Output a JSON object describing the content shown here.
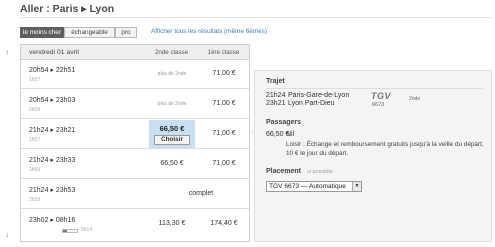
{
  "header": {
    "title": "Aller : Paris ▸ Lyon"
  },
  "filters": {
    "options": [
      "le moins cher",
      "échangeable",
      "pro"
    ],
    "active": "le moins cher",
    "show_all_fares": "Afficher tous les résultats (même 6èmes)"
  },
  "nav": {
    "up": "↑",
    "down": "↓"
  },
  "list": {
    "date": "vendredi 01 avril",
    "col_second": "2nde classe",
    "col_first": "1ère classe",
    "rows": [
      {
        "times": "20h54 ▸ 22h51",
        "duration": "1h57",
        "second": "plus de 2nde",
        "first": "71,00 €"
      },
      {
        "times": "20h54 ▸ 23h03",
        "duration": "2h09",
        "second": "plus de 2nde",
        "first": "71,00 €"
      },
      {
        "times": "21h24 ▸ 23h21",
        "duration": "1h57",
        "second": "66,50 €",
        "choose": "Choisir",
        "first": "71,00 €"
      },
      {
        "times": "21h24 ▸ 23h33",
        "duration": "2h09",
        "second": "66,50 €",
        "first": "71,00 €"
      },
      {
        "times": "21h24 ▸ 23h53",
        "duration": "2h29",
        "status": "complet"
      },
      {
        "times": "23h02 ▸ 08h16",
        "duration": "9h14",
        "second": "113,30 €",
        "first": "174,40 €",
        "occupancy": 0.3
      }
    ]
  },
  "detail": {
    "trajet": {
      "heading": "Trajet",
      "departure_time": "21h24",
      "departure_station": "Paris-Gare-de-Lyon",
      "arrival_time": "23h21",
      "arrival_station": "Lyon Part-Dieu",
      "train_brand": "TGV",
      "train_number": "6673",
      "class": "2nde"
    },
    "passagers": {
      "heading": "Passagers",
      "price": "66,50 €",
      "fare": "Nil",
      "conditions": "Loisir : Échange et remboursement gratuits jusqu'à la veille du départ, 10 € le jour du départ."
    },
    "placement": {
      "heading": "Placement",
      "hint": "si possible",
      "selected": "TGV 6673 — Automatique"
    }
  },
  "colors": {
    "selected_cell": "#c9e0f3",
    "link": "#3c7bc4",
    "active_filter": "#5f5f5f",
    "panel": "#f4f4f4"
  }
}
